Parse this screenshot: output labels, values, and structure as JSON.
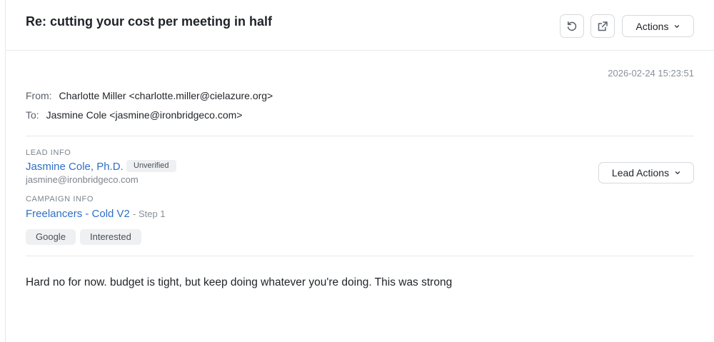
{
  "email": {
    "subject": "Re: cutting your cost per meeting in half",
    "timestamp": "2026-02-24 15:23:51",
    "from_label": "From:",
    "from_value": "Charlotte Miller <charlotte.miller@cielazure.org>",
    "to_label": "To:",
    "to_value": "Jasmine Cole <jasmine@ironbridgeco.com>",
    "body": "Hard no for now. budget is tight, but keep doing whatever you're doing. This was strong"
  },
  "toolbar": {
    "actions_label": "Actions",
    "icons": [
      "undo-icon",
      "external-link-icon",
      "chevron-down-icon"
    ]
  },
  "lead": {
    "section_label": "LEAD INFO",
    "name": "Jasmine Cole, Ph.D.",
    "status": "Unverified",
    "email": "jasmine@ironbridgeco.com",
    "actions_label": "Lead Actions"
  },
  "campaign": {
    "section_label": "CAMPAIGN INFO",
    "name": "Freelancers - Cold V2",
    "step": "- Step 1",
    "tags": [
      "Google",
      "Interested"
    ]
  },
  "colors": {
    "link": "#2f6fc6",
    "muted": "#7d848d",
    "border": "#d6d9dd",
    "tag_bg": "#eef0f2"
  }
}
